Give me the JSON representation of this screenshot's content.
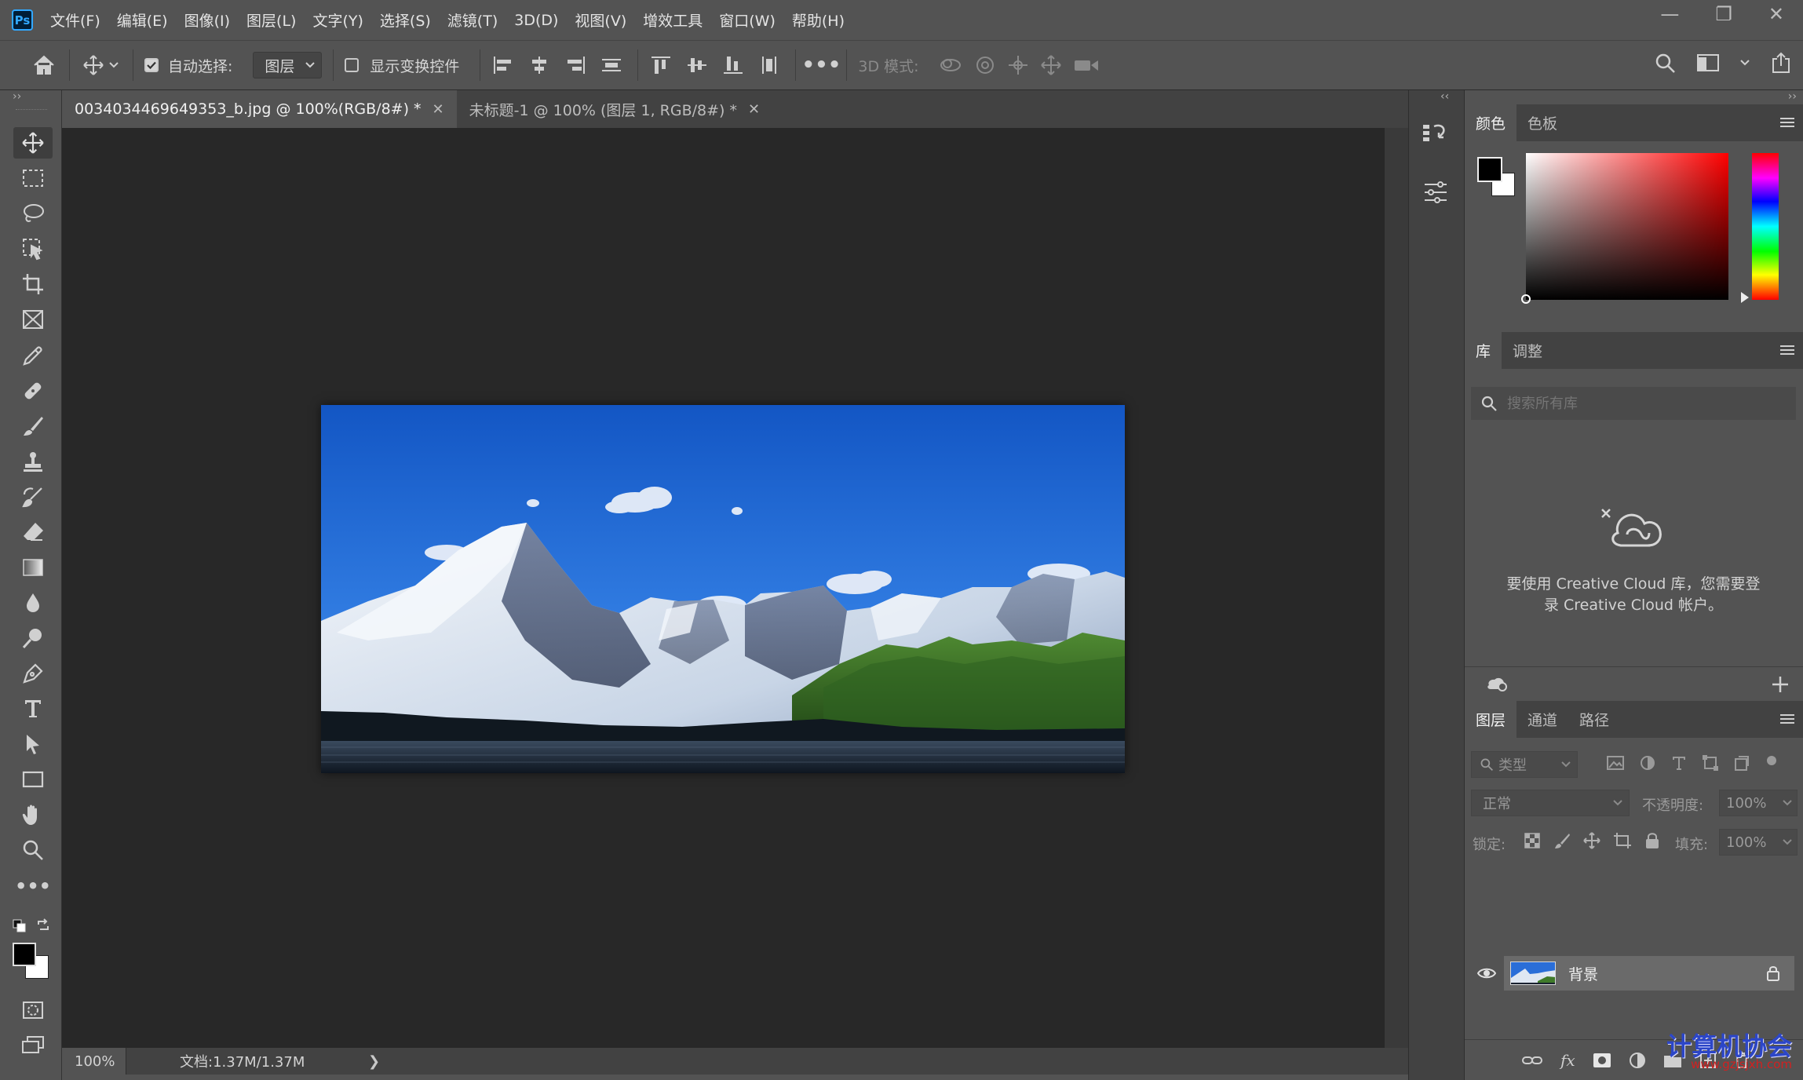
{
  "app": {
    "logo": "Ps"
  },
  "menu": [
    "文件(F)",
    "编辑(E)",
    "图像(I)",
    "图层(L)",
    "文字(Y)",
    "选择(S)",
    "滤镜(T)",
    "3D(D)",
    "视图(V)",
    "增效工具",
    "窗口(W)",
    "帮助(H)"
  ],
  "window_controls": {
    "minimize": "—",
    "restore": "❐",
    "close": "✕"
  },
  "options": {
    "auto_select_label": "自动选择:",
    "auto_select_checked": true,
    "auto_select_value": "图层",
    "show_transform_label": "显示变换控件",
    "show_transform_checked": false,
    "mode_3d_label": "3D 模式:"
  },
  "tabs": [
    {
      "label": "0034034469649353_b.jpg @ 100%(RGB/8#) *",
      "active": true
    },
    {
      "label": "未标题-1 @ 100% (图层 1, RGB/8#) *",
      "active": false
    }
  ],
  "status": {
    "zoom": "100%",
    "doc": "文档:1.37M/1.37M",
    "arrow": "❯"
  },
  "panels": {
    "color": {
      "tabs": [
        "颜色",
        "色板"
      ],
      "hue_color": "#ff0000",
      "foreground": "#000000",
      "background": "#ffffff"
    },
    "library": {
      "tabs": [
        "库",
        "调整"
      ],
      "search_placeholder": "搜索所有库",
      "message_line1": "要使用 Creative Cloud 库，您需要登",
      "message_line2": "录 Creative Cloud 帐户。"
    },
    "layers": {
      "tabs": [
        "图层",
        "通道",
        "路径"
      ],
      "filter_label": "类型",
      "blend_mode": "正常",
      "opacity_label": "不透明度:",
      "opacity_value": "100%",
      "lock_label": "锁定:",
      "fill_label": "填充:",
      "fill_value": "100%",
      "rows": [
        {
          "name": "背景",
          "visible": true,
          "locked": true
        }
      ]
    }
  },
  "watermark": {
    "line1": "计算机协会",
    "line2": "www.gzjsjxh.com"
  }
}
